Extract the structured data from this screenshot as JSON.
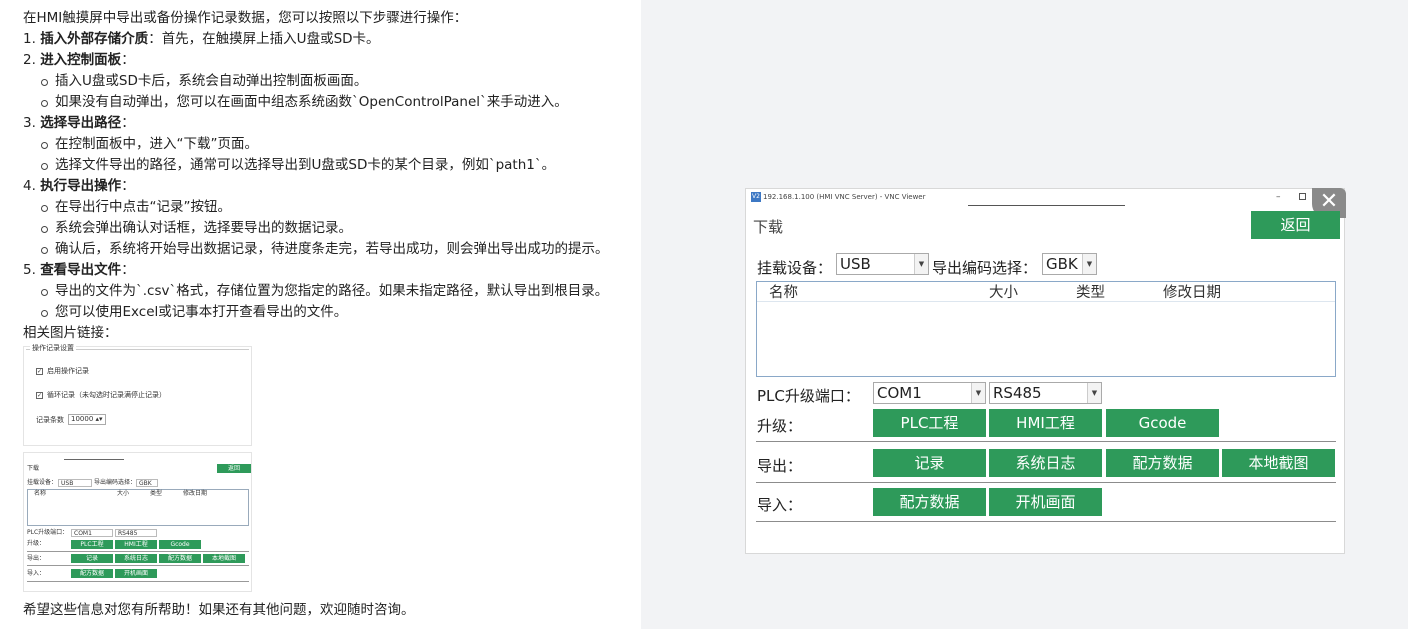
{
  "answer": {
    "intro": "在HMI触摸屏中导出或备份操作记录数据，您可以按照以下步骤进行操作：",
    "steps": [
      {
        "num": "1.",
        "title": "插入外部存储介质",
        "colon": "：",
        "text": "首先，在触摸屏上插入U盘或SD卡。",
        "items": []
      },
      {
        "num": "2.",
        "title": "进入控制面板",
        "colon": "：",
        "text": "",
        "items": [
          "插入U盘或SD卡后，系统会自动弹出控制面板画面。",
          "如果没有自动弹出，您可以在画面中组态系统函数`OpenControlPanel`来手动进入。"
        ]
      },
      {
        "num": "3.",
        "title": "选择导出路径",
        "colon": "：",
        "text": "",
        "items": [
          "在控制面板中，进入“下载”页面。",
          "选择文件导出的路径，通常可以选择导出到U盘或SD卡的某个目录，例如`path1`。"
        ]
      },
      {
        "num": "4.",
        "title": "执行导出操作",
        "colon": "：",
        "text": "",
        "items": [
          "在导出行中点击“记录”按钮。",
          "系统会弹出确认对话框，选择要导出的数据记录。",
          "确认后，系统将开始导出数据记录，待进度条走完，若导出成功，则会弹出导出成功的提示。"
        ]
      },
      {
        "num": "5.",
        "title": "查看导出文件",
        "colon": "：",
        "text": "",
        "items": [
          "导出的文件为`.csv`格式，存储位置为您指定的路径。如果未指定路径，默认导出到根目录。",
          "您可以使用Excel或记事本打开查看导出的文件。"
        ]
      }
    ],
    "links_label": "相关图片链接：",
    "closing": "希望这些信息对您有所帮助！如果还有其他问题，欢迎随时咨询。"
  },
  "thumb1": {
    "legend": "操作记录设置",
    "enable": "启用操作记录",
    "loop": "循环记录（未勾选时记录满停止记录）",
    "count_label": "记录条数",
    "count_value": "10000"
  },
  "thumb2": {
    "title": "下载",
    "back": "返回",
    "device_label": "挂载设备：",
    "device": "USB",
    "enc_label": "导出编码选择：",
    "enc": "GBK",
    "col_name": "名称",
    "col_size": "大小",
    "col_type": "类型",
    "col_date": "修改日期",
    "port_label": "PLC升级端口：",
    "port1": "COM1",
    "port2": "RS485",
    "upgrade_label": "升级：",
    "export_label": "导出：",
    "import_label": "导入：",
    "btn_plc": "PLC工程",
    "btn_hmi": "HMI工程",
    "btn_gcode": "Gcode",
    "btn_record": "记录",
    "btn_syslog": "系统日志",
    "btn_recipe": "配方数据",
    "btn_screenshot": "本地截图",
    "btn_boot": "开机画面"
  },
  "vnc": {
    "window_title": "192.168.1.100 (HMI VNC Server) - VNC Viewer",
    "app_icon": "V2",
    "page_title": "下载",
    "back_button": "返回",
    "device_label": "挂载设备：",
    "device_value": "USB",
    "encoding_label": "导出编码选择：",
    "encoding_value": "GBK",
    "columns": [
      "名称",
      "大小",
      "类型",
      "修改日期"
    ],
    "port_label": "PLC升级端口：",
    "port_value": "COM1",
    "protocol_value": "RS485",
    "upgrade_label": "升级：",
    "upgrade_buttons": [
      "PLC工程",
      "HMI工程",
      "Gcode"
    ],
    "export_label": "导出：",
    "export_buttons": [
      "记录",
      "系统日志",
      "配方数据",
      "本地截图"
    ],
    "import_label": "导入：",
    "import_buttons": [
      "配方数据",
      "开机画面"
    ],
    "close_glyph": "✕",
    "minimize_glyph": "–"
  },
  "colors": {
    "accent_green": "#2e9a5a",
    "page_bg": "#f2f3f5",
    "panel_bg": "#ffffff"
  }
}
